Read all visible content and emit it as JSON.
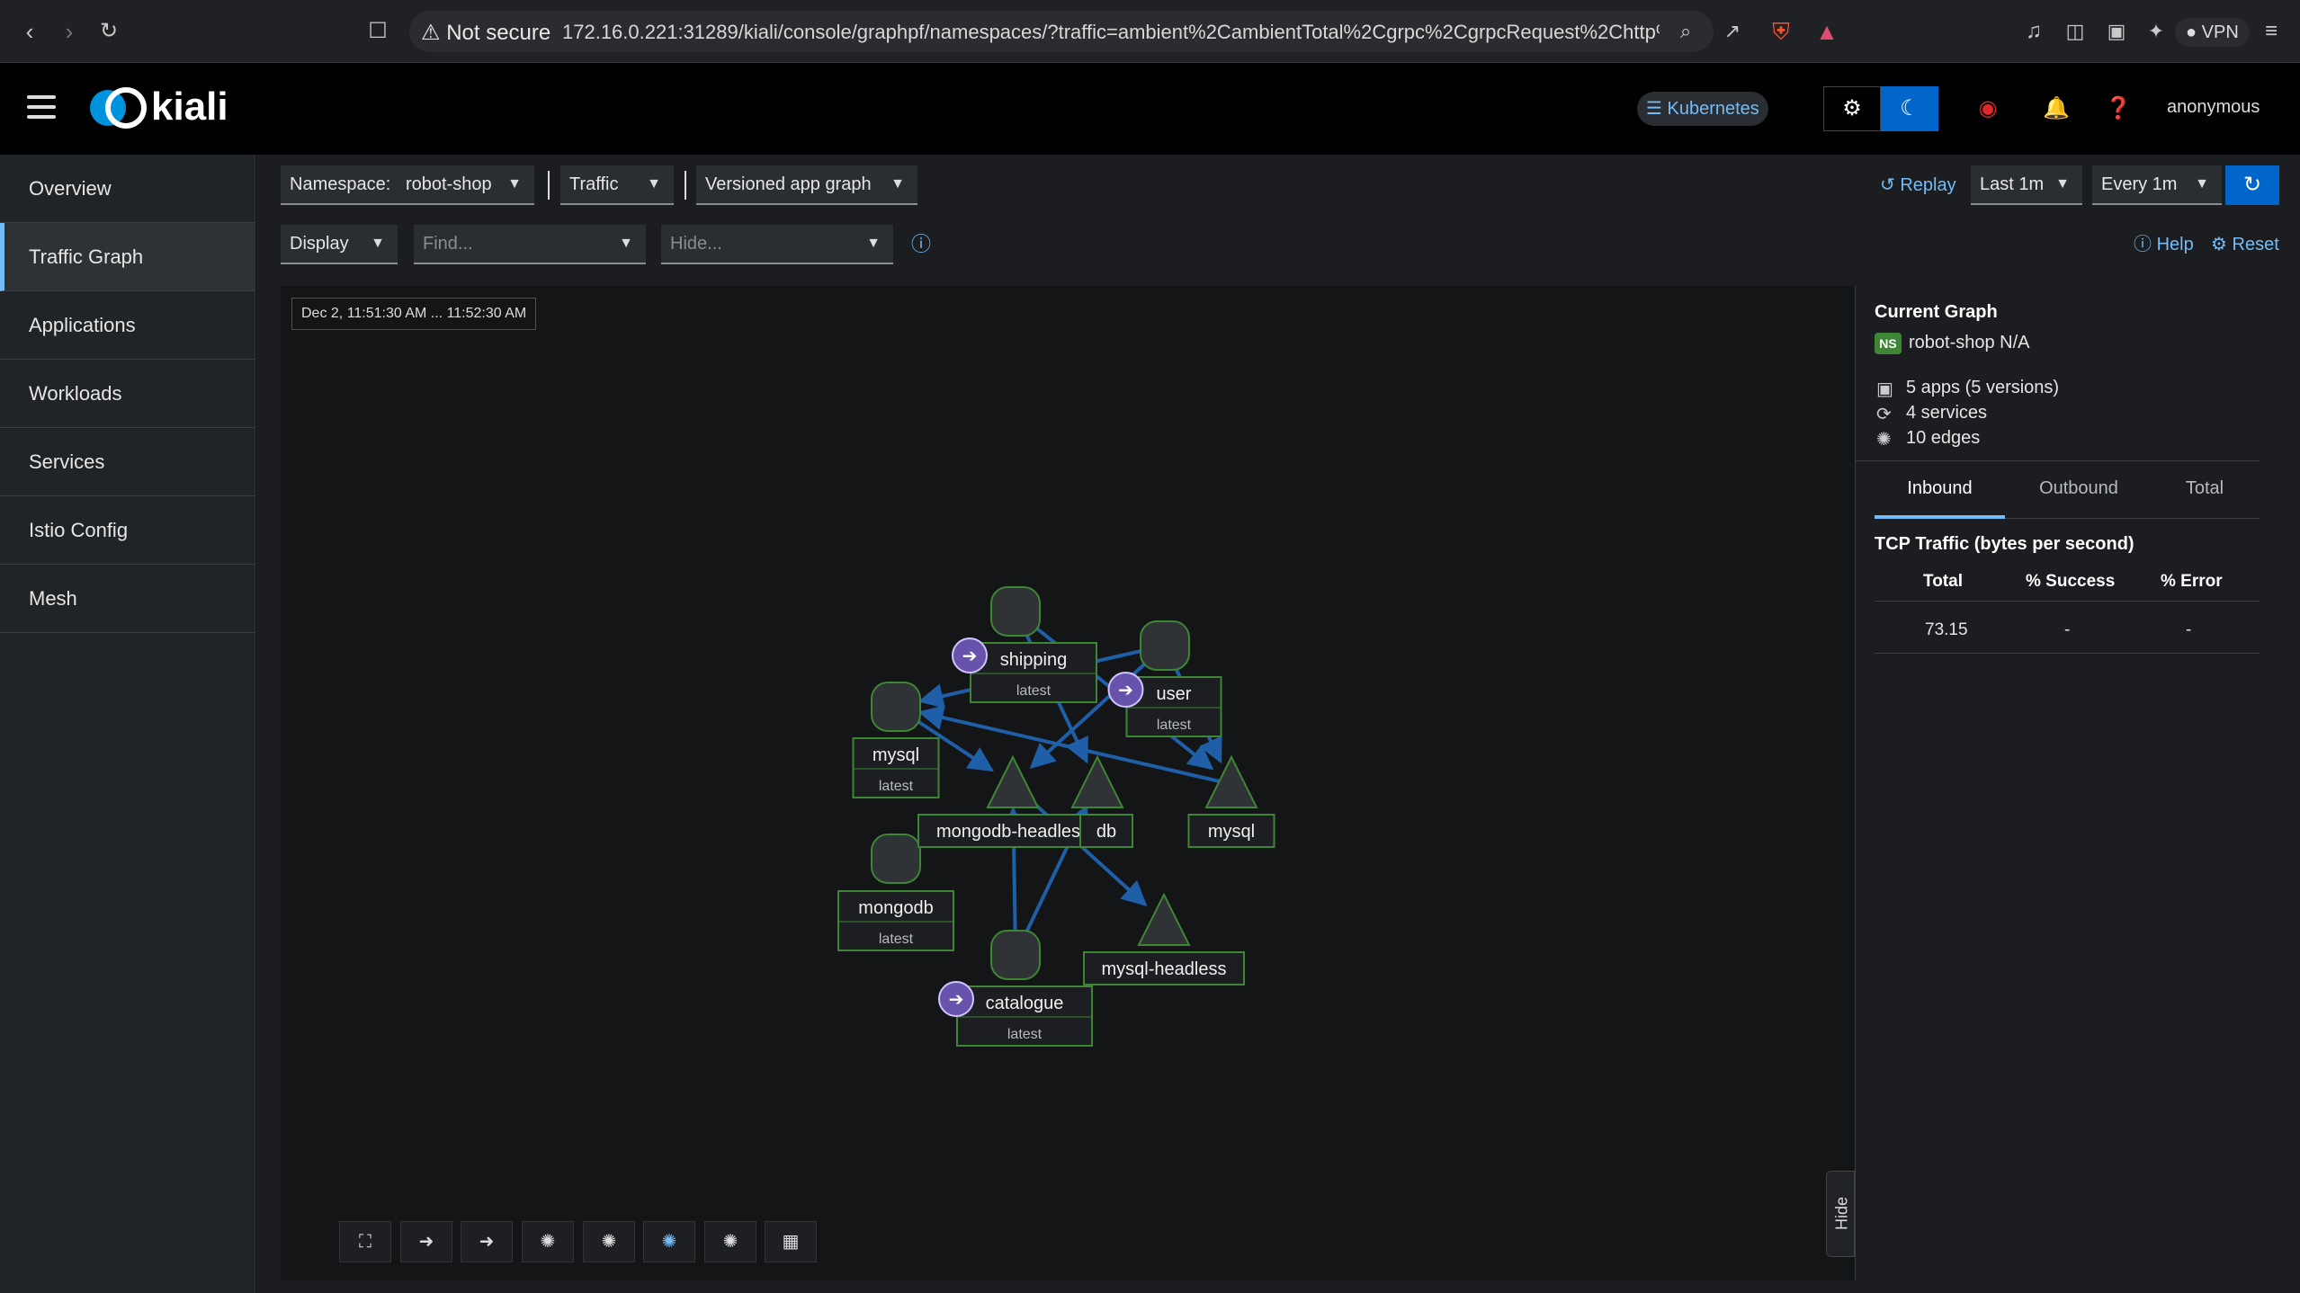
{
  "browser": {
    "security": "Not secure",
    "url": "172.16.0.221:31289/kiali/console/graphpf/namespaces/?traffic=ambient%2CambientTotal%2Cgrpc%2CgrpcRequest%2Chttp%2Ch...",
    "vpn": "VPN"
  },
  "header": {
    "logo": "kiali",
    "cluster": "Kubernetes",
    "user": "anonymous"
  },
  "sidebar": {
    "items": [
      {
        "label": "Overview"
      },
      {
        "label": "Traffic Graph"
      },
      {
        "label": "Applications"
      },
      {
        "label": "Workloads"
      },
      {
        "label": "Services"
      },
      {
        "label": "Istio Config"
      },
      {
        "label": "Mesh"
      }
    ],
    "active": "Traffic Graph"
  },
  "toolbar": {
    "namespace_label": "Namespace:",
    "namespace_value": "robot-shop",
    "traffic": "Traffic",
    "graph_type": "Versioned app graph",
    "display": "Display",
    "find_placeholder": "Find...",
    "hide_placeholder": "Hide...",
    "replay": "Replay",
    "duration": "Last 1m",
    "refresh_interval": "Every 1m",
    "help": "Help",
    "reset": "Reset"
  },
  "graph": {
    "timestamp": "Dec 2, 11:51:30 AM ... 11:52:30 AM",
    "nodes": [
      {
        "id": "shipping",
        "kind": "app",
        "label": "shipping",
        "version": "latest",
        "gateway": true
      },
      {
        "id": "user",
        "kind": "app",
        "label": "user",
        "version": "latest",
        "gateway": true
      },
      {
        "id": "mysql-app",
        "kind": "app",
        "label": "mysql",
        "version": "latest",
        "gateway": false
      },
      {
        "id": "mongodb-app",
        "kind": "app",
        "label": "mongodb",
        "version": "latest",
        "gateway": false
      },
      {
        "id": "catalogue",
        "kind": "app",
        "label": "catalogue",
        "version": "latest",
        "gateway": true
      },
      {
        "id": "mongodb-headless",
        "kind": "service",
        "label": "mongodb-headless"
      },
      {
        "id": "mongodb-svc",
        "kind": "service",
        "label": "db"
      },
      {
        "id": "mysql-svc",
        "kind": "service",
        "label": "mysql"
      },
      {
        "id": "mysql-headless",
        "kind": "service",
        "label": "mysql-headless"
      }
    ],
    "edge_color": "#1f5fa8"
  },
  "panel": {
    "title": "Current Graph",
    "ns_badge": "NS",
    "namespace": "robot-shop N/A",
    "apps": "5 apps (5 versions)",
    "services": "4 services",
    "edges": "10 edges",
    "tabs": [
      "Inbound",
      "Outbound",
      "Total"
    ],
    "active_tab": "Inbound",
    "section": "TCP Traffic (bytes per second)",
    "table": {
      "headers": [
        "Total",
        "% Success",
        "% Error"
      ],
      "row": [
        "73.15",
        "-",
        "-"
      ]
    }
  },
  "hide_tab": "Hide",
  "colors": {
    "accent": "#0066cc",
    "link": "#73bcf7",
    "node_border": "#3e8635",
    "gateway_badge": "#6753ac"
  }
}
